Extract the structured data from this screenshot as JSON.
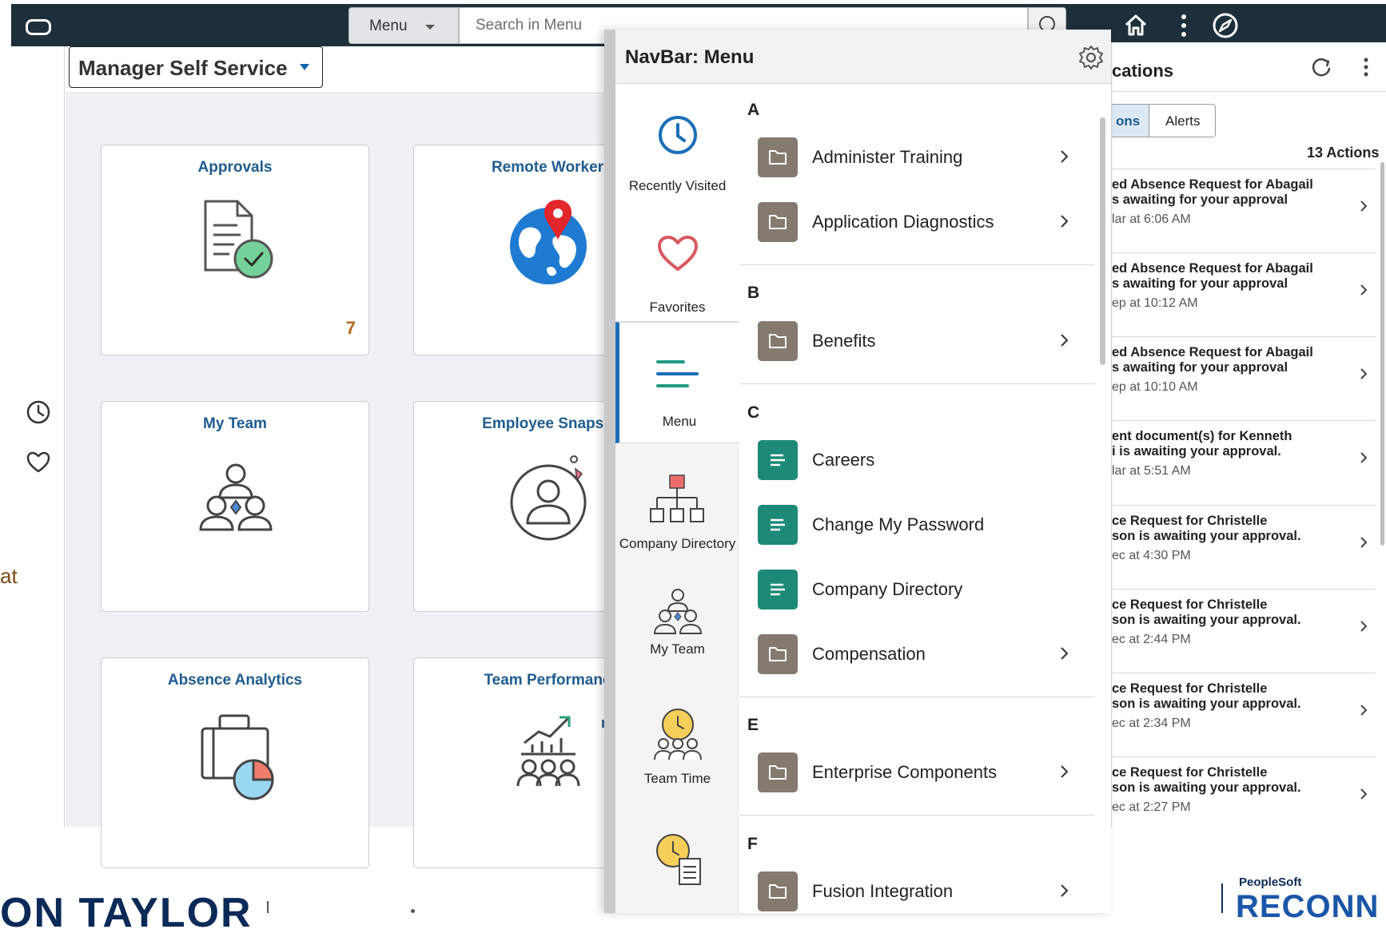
{
  "topbar": {
    "menu_select_label": "Menu",
    "search_placeholder": "Search in Menu",
    "home_icon": "home-icon",
    "actions_icon": "more-vertical-icon",
    "navbar_icon": "compass-icon"
  },
  "homepage": {
    "selected": "Manager Self Service"
  },
  "tiles": [
    {
      "title": "Approvals",
      "icon": "document-check-icon",
      "count": "7"
    },
    {
      "title": "Remote Worker",
      "icon": "globe-pin-icon"
    },
    {
      "title": "My Team",
      "icon": "team-icon"
    },
    {
      "title": "Employee Snapsh",
      "icon": "person-circle-icon"
    },
    {
      "title": "Absence Analytics",
      "icon": "briefcase-pie-icon"
    },
    {
      "title": "Team Performanc",
      "icon": "team-chart-icon"
    }
  ],
  "left_fragment": "at",
  "tile_fragment": "n",
  "navbar": {
    "title": "NavBar: Menu",
    "settings_icon": "gear-icon",
    "side": [
      {
        "label": "Recently Visited",
        "icon": "clock-icon"
      },
      {
        "label": "Favorites",
        "icon": "heart-icon"
      },
      {
        "label": "Menu",
        "icon": "menu-lines-icon",
        "selected": true
      },
      {
        "label": "Company Directory",
        "icon": "org-chart-icon"
      },
      {
        "label": "My Team",
        "icon": "team-icon"
      },
      {
        "label": "Team Time",
        "icon": "team-clock-icon"
      },
      {
        "label": "",
        "icon": "clock-document-icon"
      }
    ],
    "sections": [
      {
        "letter": "A",
        "items": [
          {
            "label": "Administer Training",
            "type": "folder"
          },
          {
            "label": "Application Diagnostics",
            "type": "folder"
          }
        ]
      },
      {
        "letter": "B",
        "items": [
          {
            "label": "Benefits",
            "type": "folder"
          }
        ]
      },
      {
        "letter": "C",
        "items": [
          {
            "label": "Careers",
            "type": "page"
          },
          {
            "label": "Change My Password",
            "type": "page"
          },
          {
            "label": "Company Directory",
            "type": "page"
          },
          {
            "label": "Compensation",
            "type": "folder"
          }
        ]
      },
      {
        "letter": "E",
        "items": [
          {
            "label": "Enterprise Components",
            "type": "folder"
          }
        ]
      },
      {
        "letter": "F",
        "items": [
          {
            "label": "Fusion Integration",
            "type": "folder"
          }
        ]
      }
    ]
  },
  "notifications": {
    "title": "cations",
    "tab_actions": "ons",
    "tab_alerts": "Alerts",
    "count": "13 Actions",
    "rows": [
      {
        "l1": "ed Absence Request for Abagail",
        "l2": "s awaiting for your approval",
        "l3": "lar at 6:06 AM"
      },
      {
        "l1": "ed Absence Request for Abagail",
        "l2": "s awaiting for your approval",
        "l3": "ep at 10:12 AM"
      },
      {
        "l1": "ed Absence Request for Abagail",
        "l2": "s awaiting for your approval",
        "l3": "ep at 10:10 AM"
      },
      {
        "l1": "ent document(s) for Kenneth",
        "l2": "i is awaiting your approval.",
        "l3": "lar at 5:51 AM"
      },
      {
        "l1": "ce Request for Christelle",
        "l2": "son is awaiting your approval.",
        "l3": "ec at 4:30 PM"
      },
      {
        "l1": "ce Request for Christelle",
        "l2": "son is awaiting your approval.",
        "l3": "ec at 2:44 PM"
      },
      {
        "l1": "ce Request for Christelle",
        "l2": "son is awaiting your approval.",
        "l3": "ec at 2:34 PM"
      },
      {
        "l1": "ce Request for Christelle",
        "l2": "son is awaiting your approval.",
        "l3": "ec at 2:27 PM"
      }
    ]
  },
  "slide": {
    "bottom_left_text": "ON TAYLOR",
    "peoplesoft_label": "PeopleSoft",
    "reconnect_text": "RECONN"
  },
  "colors": {
    "topbar": "#1f2f3a",
    "tile_title": "#1f5c8f",
    "count": "#b8641d",
    "folder_icon": "#857a70",
    "page_icon": "#1d8a77",
    "selected_accent": "#1a6fb8"
  }
}
